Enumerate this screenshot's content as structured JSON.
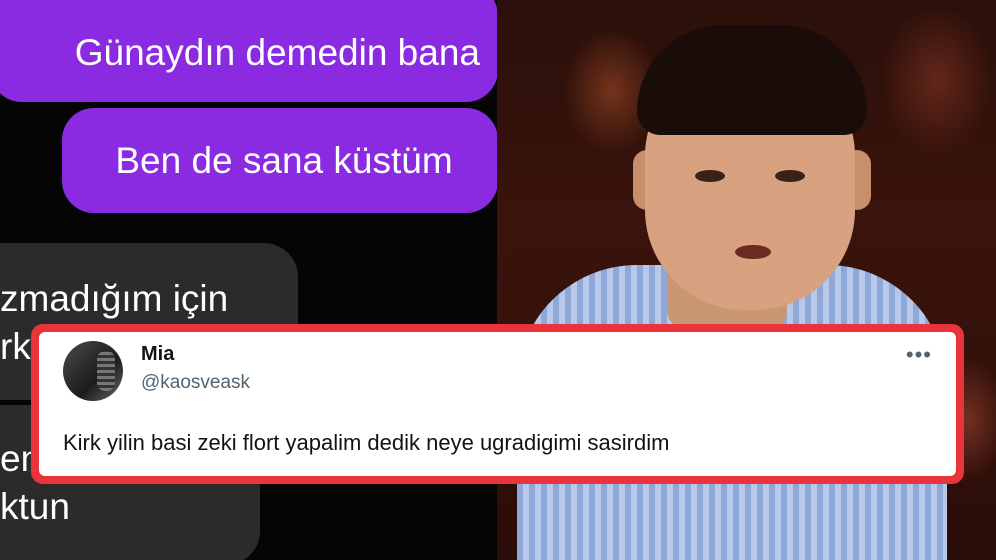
{
  "chat": {
    "outgoing": [
      "Günaydın demedin bana",
      "Ben de sana küstüm"
    ],
    "incoming": [
      "zmadığım için\nrk",
      "en\nktun"
    ],
    "colors": {
      "outgoing_bubble": "#8a2be2",
      "incoming_bubble": "#2b2b2b"
    }
  },
  "tweet": {
    "name": "Mia",
    "handle": "@kaosveask",
    "text": "Kirk yilin basi zeki flort yapalim dedik neye ugradigimi sasirdim",
    "more_icon": "more-horizontal-icon",
    "border_color": "#e8343a"
  }
}
